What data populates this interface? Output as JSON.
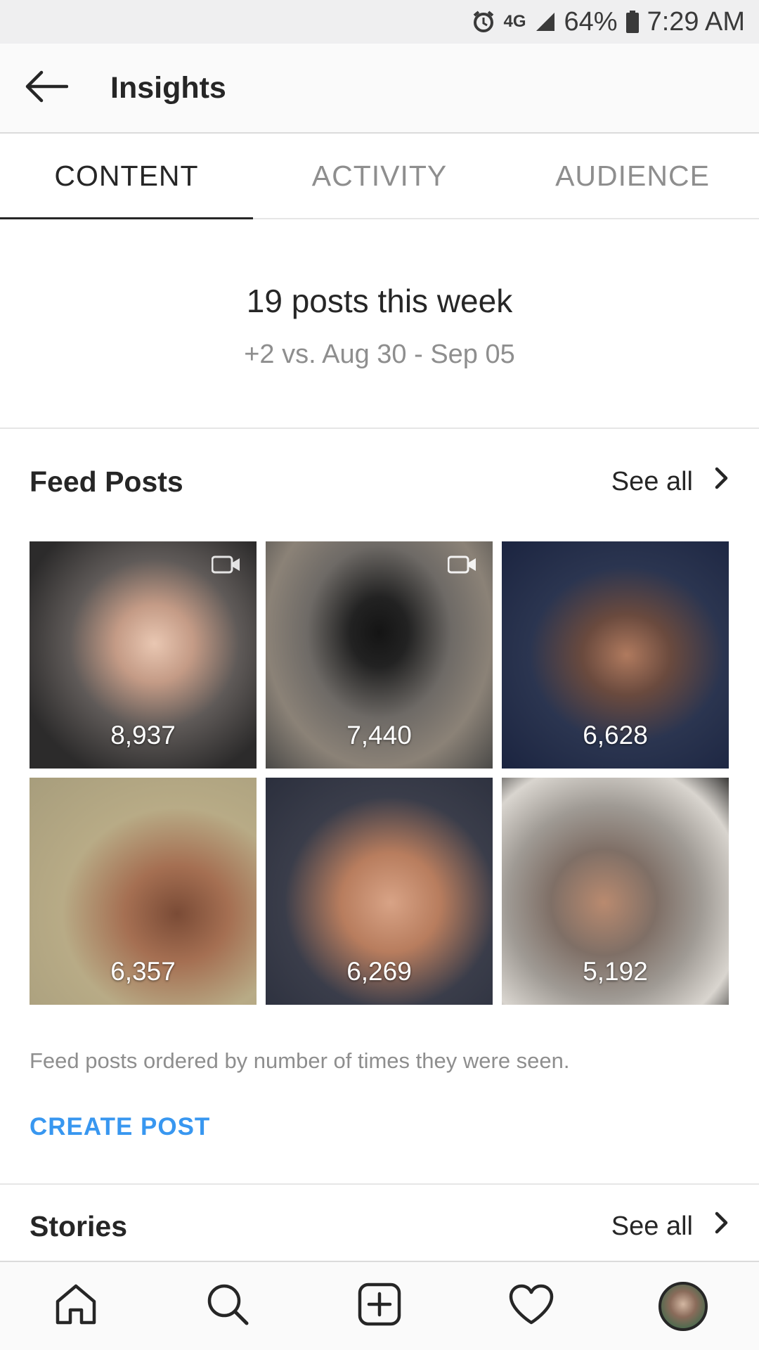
{
  "status_bar": {
    "network": "4G",
    "battery": "64%",
    "time": "7:29 AM"
  },
  "header": {
    "title": "Insights"
  },
  "tabs": [
    {
      "label": "CONTENT",
      "active": true
    },
    {
      "label": "ACTIVITY",
      "active": false
    },
    {
      "label": "AUDIENCE",
      "active": false
    }
  ],
  "summary": {
    "title": "19 posts this week",
    "comparison": "+2 vs. Aug 30 - Sep 05"
  },
  "feed_posts": {
    "title": "Feed Posts",
    "see_all": "See all",
    "posts": [
      {
        "count": "8,937",
        "is_video": true
      },
      {
        "count": "7,440",
        "is_video": true
      },
      {
        "count": "6,628",
        "is_video": false
      },
      {
        "count": "6,357",
        "is_video": false
      },
      {
        "count": "6,269",
        "is_video": false
      },
      {
        "count": "5,192",
        "is_video": false
      }
    ],
    "footnote": "Feed posts ordered by number of times they were seen.",
    "create_label": "CREATE POST"
  },
  "stories": {
    "title": "Stories",
    "see_all": "See all"
  },
  "bottom_nav": {
    "items": [
      "home-icon",
      "search-icon",
      "add-icon",
      "heart-icon",
      "profile-avatar"
    ]
  },
  "colors": {
    "accent": "#3897f0",
    "text": "#262626",
    "secondary_text": "#8e8e8e"
  }
}
